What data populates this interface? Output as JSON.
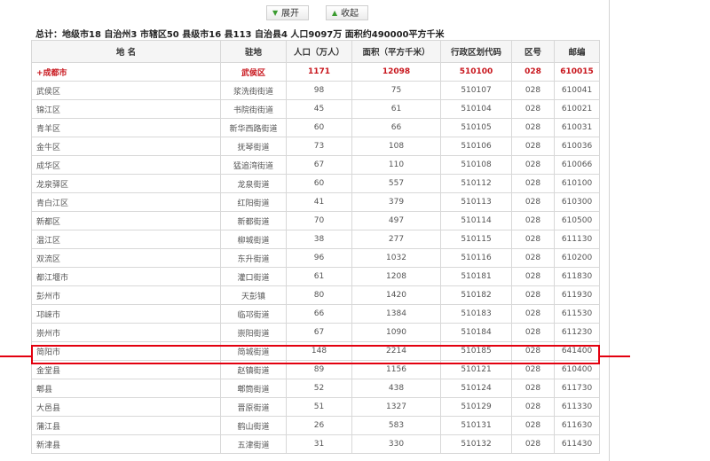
{
  "toolbar": {
    "expand_label": "展开",
    "collapse_label": "收起"
  },
  "summary": "总计：地级市18  自治州3  市辖区50  县级市16  县113  自治县4  人口9097万  面积约490000平方千米",
  "table": {
    "headers": [
      "地 名",
      "驻地",
      "人口（万人）",
      "面积（平方千米）",
      "行政区划代码",
      "区号",
      "邮编"
    ],
    "city_row": [
      "+成都市",
      "武侯区",
      "1171",
      "12098",
      "510100",
      "028",
      "610015"
    ],
    "rows": [
      [
        "武侯区",
        "浆洗街街道",
        "98",
        "75",
        "510107",
        "028",
        "610041"
      ],
      [
        "锦江区",
        "书院街街道",
        "45",
        "61",
        "510104",
        "028",
        "610021"
      ],
      [
        "青羊区",
        "新华西路街道",
        "60",
        "66",
        "510105",
        "028",
        "610031"
      ],
      [
        "金牛区",
        "抚琴街道",
        "73",
        "108",
        "510106",
        "028",
        "610036"
      ],
      [
        "成华区",
        "猛追湾街道",
        "67",
        "110",
        "510108",
        "028",
        "610066"
      ],
      [
        "龙泉驿区",
        "龙泉街道",
        "60",
        "557",
        "510112",
        "028",
        "610100"
      ],
      [
        "青白江区",
        "红阳街道",
        "41",
        "379",
        "510113",
        "028",
        "610300"
      ],
      [
        "新都区",
        "新都街道",
        "70",
        "497",
        "510114",
        "028",
        "610500"
      ],
      [
        "温江区",
        "柳城街道",
        "38",
        "277",
        "510115",
        "028",
        "611130"
      ],
      [
        "双流区",
        "东升街道",
        "96",
        "1032",
        "510116",
        "028",
        "610200"
      ],
      [
        "都江堰市",
        "灌口街道",
        "61",
        "1208",
        "510181",
        "028",
        "611830"
      ],
      [
        "彭州市",
        "天彭镇",
        "80",
        "1420",
        "510182",
        "028",
        "611930"
      ],
      [
        "邛崃市",
        "临邛街道",
        "66",
        "1384",
        "510183",
        "028",
        "611530"
      ],
      [
        "崇州市",
        "崇阳街道",
        "67",
        "1090",
        "510184",
        "028",
        "611230"
      ],
      [
        "简阳市",
        "简城街道",
        "148",
        "2214",
        "510185",
        "028",
        "641400"
      ],
      [
        "金堂县",
        "赵镇街道",
        "89",
        "1156",
        "510121",
        "028",
        "610400"
      ],
      [
        "郫县",
        "郫筒街道",
        "52",
        "438",
        "510124",
        "028",
        "611730"
      ],
      [
        "大邑县",
        "晋原街道",
        "51",
        "1327",
        "510129",
        "028",
        "611330"
      ],
      [
        "蒲江县",
        "鹤山街道",
        "26",
        "583",
        "510131",
        "028",
        "611630"
      ],
      [
        "新津县",
        "五津街道",
        "31",
        "330",
        "510132",
        "028",
        "611430"
      ]
    ]
  }
}
